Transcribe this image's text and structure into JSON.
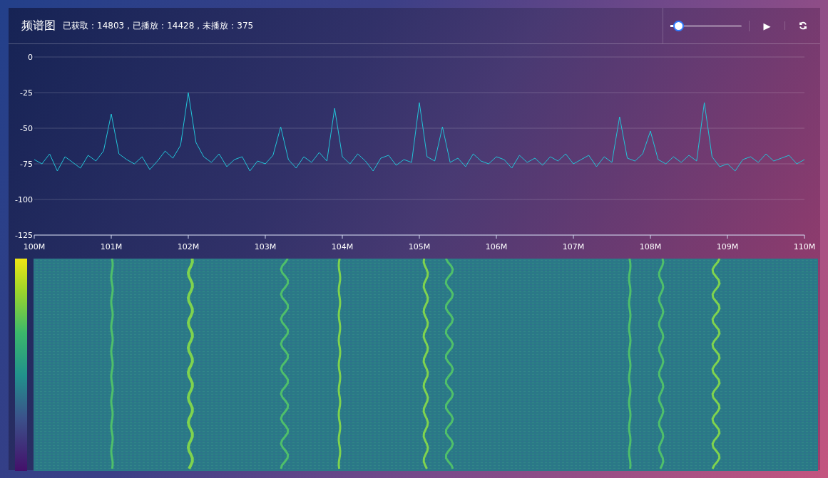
{
  "header": {
    "title": "频谱图",
    "stats": "已获取：14803，已播放：14428，未播放：375"
  },
  "controls": {
    "slider": {
      "level": 0.1
    },
    "play_button": "▶"
  },
  "spectrum": {
    "chart_data": {
      "type": "line",
      "xlim": [
        100,
        110
      ],
      "ylim": [
        -125,
        0
      ],
      "grid": true,
      "yticks": [
        0,
        -25,
        -50,
        -75,
        -100,
        -125
      ],
      "xticks": [
        {
          "value": 100,
          "label": "100M"
        },
        {
          "value": 101,
          "label": "101M"
        },
        {
          "value": 102,
          "label": "102M"
        },
        {
          "value": 103,
          "label": "103M"
        },
        {
          "value": 104,
          "label": "104M"
        },
        {
          "value": 105,
          "label": "105M"
        },
        {
          "value": 106,
          "label": "106M"
        },
        {
          "value": 107,
          "label": "107M"
        },
        {
          "value": 108,
          "label": "108M"
        },
        {
          "value": 109,
          "label": "109M"
        },
        {
          "value": 110,
          "label": "110M"
        }
      ],
      "x": [
        100,
        100.1,
        100.2,
        100.3,
        100.4,
        100.5,
        100.6,
        100.7,
        100.8,
        100.9,
        101,
        101.1,
        101.2,
        101.3,
        101.4,
        101.5,
        101.6,
        101.7,
        101.8,
        101.9,
        102,
        102.1,
        102.2,
        102.3,
        102.4,
        102.5,
        102.6,
        102.7,
        102.8,
        102.9,
        103,
        103.1,
        103.2,
        103.3,
        103.4,
        103.5,
        103.6,
        103.7,
        103.8,
        103.9,
        104,
        104.1,
        104.2,
        104.3,
        104.4,
        104.5,
        104.6,
        104.7,
        104.8,
        104.9,
        105,
        105.1,
        105.2,
        105.3,
        105.4,
        105.5,
        105.6,
        105.7,
        105.8,
        105.9,
        106,
        106.1,
        106.2,
        106.3,
        106.4,
        106.5,
        106.6,
        106.7,
        106.8,
        106.9,
        107,
        107.1,
        107.2,
        107.3,
        107.4,
        107.5,
        107.6,
        107.7,
        107.8,
        107.9,
        108,
        108.1,
        108.2,
        108.3,
        108.4,
        108.5,
        108.6,
        108.7,
        108.8,
        108.9,
        109,
        109.1,
        109.2,
        109.3,
        109.4,
        109.5,
        109.6,
        109.7,
        109.8,
        109.9,
        110
      ],
      "series": [
        {
          "color": "#22c4d8",
          "values": [
            -72,
            -75,
            -68,
            -80,
            -70,
            -74,
            -78,
            -69,
            -73,
            -66,
            -40,
            -68,
            -72,
            -75,
            -70,
            -79,
            -73,
            -66,
            -71,
            -62,
            -25,
            -60,
            -70,
            -74,
            -68,
            -77,
            -72,
            -70,
            -80,
            -73,
            -75,
            -69,
            -49,
            -72,
            -78,
            -70,
            -74,
            -67,
            -73,
            -36,
            -70,
            -75,
            -68,
            -73,
            -80,
            -71,
            -69,
            -76,
            -72,
            -74,
            -32,
            -70,
            -73,
            -49,
            -74,
            -71,
            -77,
            -68,
            -73,
            -75,
            -70,
            -72,
            -78,
            -69,
            -74,
            -71,
            -76,
            -70,
            -73,
            -68,
            -75,
            -72,
            -69,
            -77,
            -70,
            -74,
            -42,
            -71,
            -73,
            -68,
            -52,
            -72,
            -75,
            -70,
            -74,
            -69,
            -73,
            -32,
            -70,
            -77,
            -75,
            -80,
            -72,
            -70,
            -74,
            -68,
            -73,
            -71,
            -69,
            -75,
            -72
          ]
        }
      ]
    }
  }
}
